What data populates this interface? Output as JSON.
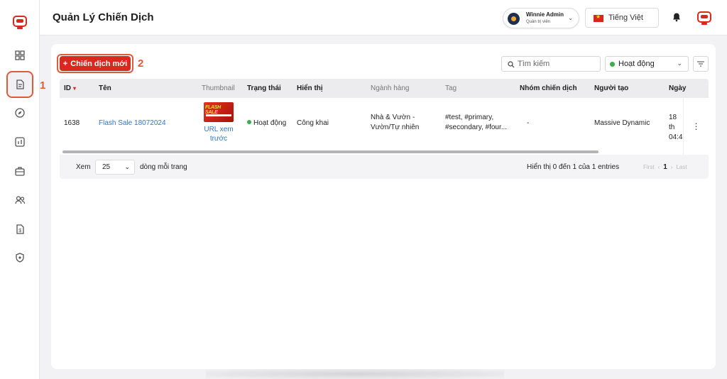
{
  "header": {
    "title": "Quản Lý Chiến Dịch",
    "user_name": "Winnie Admin",
    "user_role": "Quản trị viên",
    "language": "Tiếng Việt"
  },
  "toolbar": {
    "new_campaign": "Chiến dịch mới",
    "search_placeholder": "Tìm kiếm",
    "status_filter": "Hoạt động"
  },
  "annotations": {
    "one": "1",
    "two": "2"
  },
  "table": {
    "columns": [
      "ID",
      "Tên",
      "Thumbnail",
      "Trạng thái",
      "Hiển thị",
      "Ngành hàng",
      "Tag",
      "Nhóm chiến dịch",
      "Người tạo",
      "Ngày"
    ],
    "rows": [
      {
        "id": "1638",
        "name": "Flash Sale 18072024",
        "thumbnail_text": "FLASH SALE",
        "thumbnail_link": "URL xem trước",
        "status": "Hoạt động",
        "visibility": "Công khai",
        "category": "Nhà & Vườn - Vườn/Tự nhiên",
        "tags": "#test, #primary, #secondary, #four...",
        "group": "-",
        "creator": "Massive Dynamic",
        "date": "18 th 04:4"
      }
    ]
  },
  "footer": {
    "show_label": "Xem",
    "per_page": "25",
    "per_page_suffix": "dòng mỗi trang",
    "entries": "Hiển thị 0 đến 1 của 1 entries",
    "first": "First",
    "prev": "‹",
    "page": "1",
    "next": "›",
    "last": "Last"
  },
  "colors": {
    "brand": "#d72a1f",
    "accent": "#e05a3a",
    "link": "#2e74c9",
    "active": "#3aae4a"
  },
  "icons": [
    "robot-logo-icon",
    "dashboard-icon",
    "document-icon",
    "compass-icon",
    "chart-icon",
    "briefcase-icon",
    "users-icon",
    "invoice-icon",
    "shield-icon",
    "bell-icon",
    "search-icon",
    "filter-icon"
  ]
}
